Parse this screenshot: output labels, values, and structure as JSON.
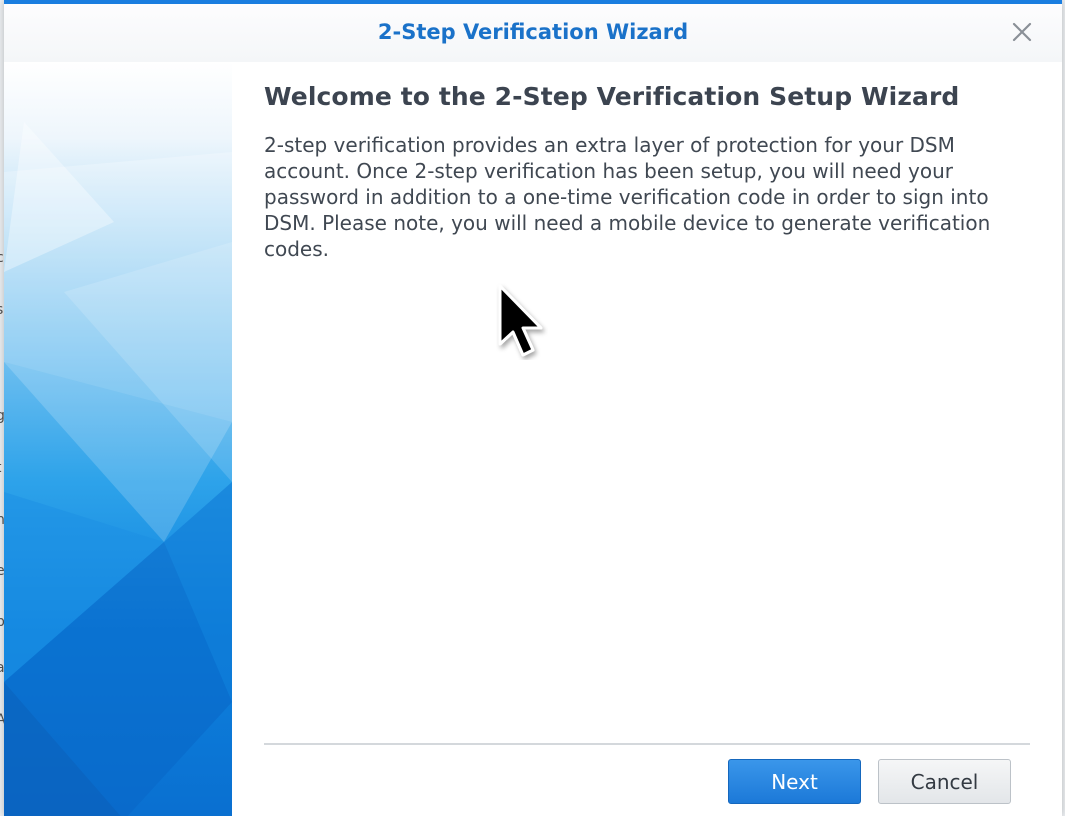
{
  "window": {
    "title": "2-Step Verification Wizard",
    "accent_color": "#1a7ee0",
    "close_icon": "close-icon"
  },
  "content": {
    "heading": "Welcome to the 2-Step Verification Setup Wizard",
    "description": "2-step verification provides an extra layer of protection for your DSM account. Once 2-step verification has been setup, you will need your password in addition to a one-time verification code in order to sign into DSM. Please note, you will need a mobile device to generate verification codes."
  },
  "footer": {
    "next_label": "Next",
    "cancel_label": "Cancel"
  },
  "background_fragments": [
    "c",
    "s",
    "g",
    "t",
    "n",
    "e",
    "b",
    "a",
    "A"
  ]
}
